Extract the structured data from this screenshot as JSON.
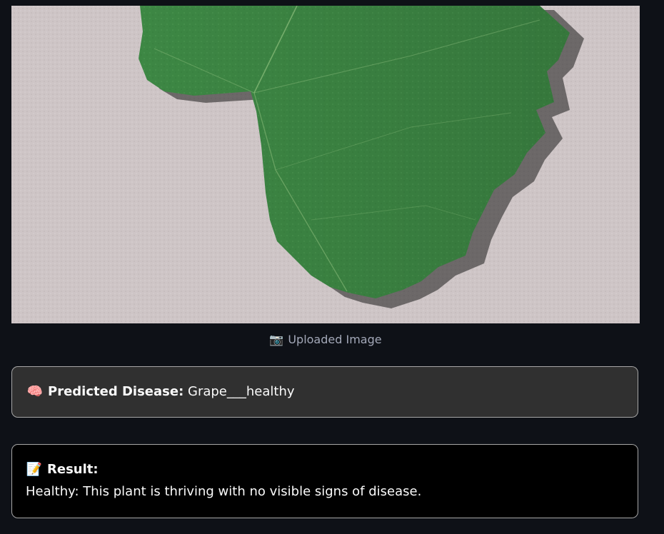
{
  "uploaded_image": {
    "caption_icon": "📷",
    "caption": "Uploaded Image",
    "subject": "green grape leaf on grey fabric background"
  },
  "prediction": {
    "icon": "🧠",
    "label": "Predicted Disease:",
    "value": "Grape___healthy"
  },
  "result": {
    "icon": "📝",
    "label": "Result:",
    "text": "Healthy: This plant is thriving with no visible signs of disease."
  },
  "colors": {
    "background": "#0e1117",
    "prediction_box": "#303030",
    "result_box": "#000000",
    "leaf": "#3f8a45",
    "fabric": "#cfc6c6"
  }
}
